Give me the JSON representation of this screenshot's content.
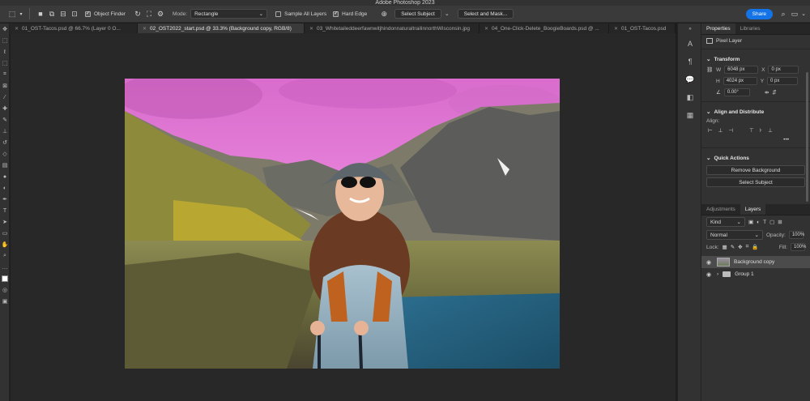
{
  "app": {
    "title": "Adobe Photoshop 2023"
  },
  "options": {
    "object_finder": "Object Finder",
    "mode_label": "Mode:",
    "mode_value": "Rectangle",
    "sample_all_layers": "Sample All Layers",
    "hard_edge": "Hard Edge",
    "select_subject": "Select Subject",
    "select_and_mask": "Select and Mask...",
    "share": "Share"
  },
  "tabs": [
    {
      "label": "01_OST-Tacos.psd @ 66.7% (Layer 0 O...",
      "active": false
    },
    {
      "label": "02_OST2022_start.psd @ 33.3% (Background copy, RGB/8)",
      "active": true
    },
    {
      "label": "03_WhitetaileddeerfawnwitjhindonnaturaltrailinnorthWisconsin.jpg",
      "active": false
    },
    {
      "label": "04_One-Click-Delete_BoogieBoards.psd @ ...",
      "active": false
    },
    {
      "label": "01_OST-Tacos.psd",
      "active": false
    }
  ],
  "properties": {
    "tab": "Properties",
    "libraries_tab": "Libraries",
    "layer_type": "Pixel Layer",
    "transform_title": "Transform",
    "w_label": "W",
    "w_value": "6048 px",
    "h_label": "H",
    "h_value": "4024 px",
    "x_label": "X",
    "x_value": "0 px",
    "y_label": "Y",
    "y_value": "0 px",
    "angle_value": "0.00°",
    "align_title": "Align and Distribute",
    "align_label": "Align:",
    "quick_actions_title": "Quick Actions",
    "remove_background": "Remove Background",
    "select_subject": "Select Subject"
  },
  "layers": {
    "adjustments_tab": "Adjustments",
    "layers_tab": "Layers",
    "kind": "Kind",
    "blend_mode": "Normal",
    "opacity_label": "Opacity:",
    "opacity_value": "100%",
    "lock_label": "Lock:",
    "fill_label": "Fill:",
    "fill_value": "100%",
    "items": [
      {
        "name": "Background copy",
        "selected": true
      },
      {
        "name": "Group 1",
        "selected": false
      }
    ]
  },
  "colors": {
    "accent": "#1473e6",
    "sky_mask": "#e27fd6",
    "panel_bg": "#323232",
    "canvas_bg": "#282828"
  }
}
